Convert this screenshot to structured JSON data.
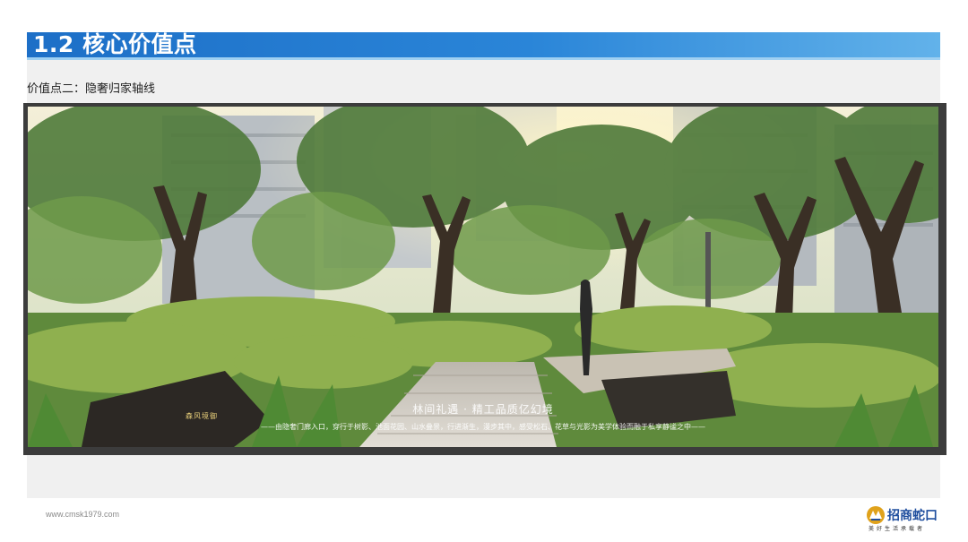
{
  "header": {
    "title": "1.2 核心价值点"
  },
  "section": {
    "subtitle": "价值点二：隐奢归家轴线"
  },
  "photo": {
    "caption_title": "林间礼遇 · 精工品质亿幻境",
    "caption_text": "——由隐奢门廊入口，穿行于树影、池面花园、山水叠景，行进渐生，漫步其中，感受松石、花草与光影为美学体验而融于私享静谧之中——",
    "stone_engraving": "森风境御"
  },
  "footer": {
    "url": "www.cmsk1979.com",
    "logo_name": "招商蛇口",
    "logo_slogan": "美好生活承载者",
    "logo_icon": "cmsk-logo-icon"
  },
  "colors": {
    "header_blue": "#1d6fc7",
    "header_light": "#62b2ea",
    "logo_blue": "#1f4e9e",
    "logo_gold": "#e0a21b"
  }
}
